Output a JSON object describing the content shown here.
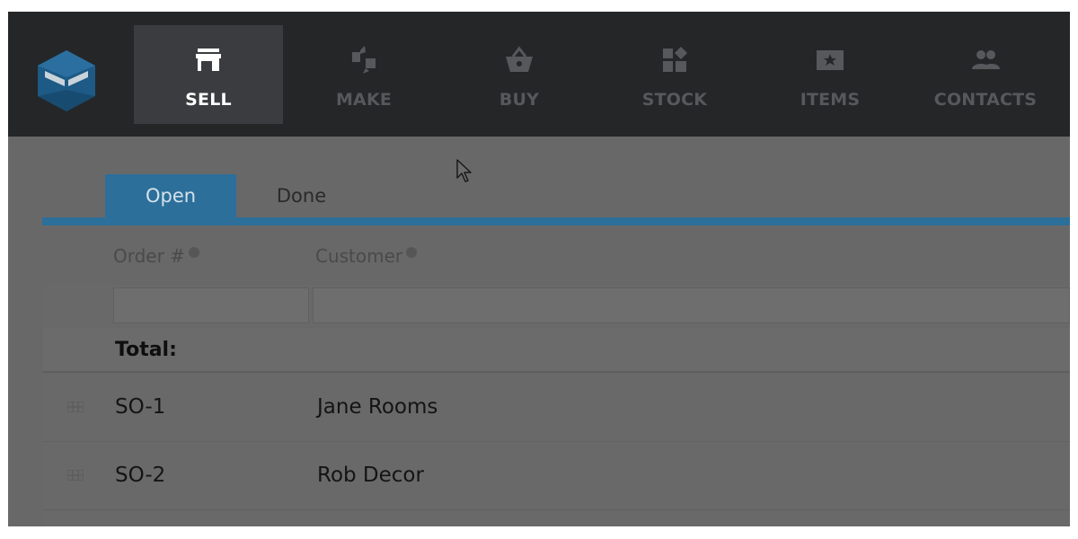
{
  "nav": {
    "items": [
      {
        "label": "SELL",
        "icon": "store-icon",
        "active": true
      },
      {
        "label": "MAKE",
        "icon": "make-icon",
        "active": false
      },
      {
        "label": "BUY",
        "icon": "basket-icon",
        "active": false
      },
      {
        "label": "STOCK",
        "icon": "stock-icon",
        "active": false
      },
      {
        "label": "ITEMS",
        "icon": "items-icon",
        "active": false
      },
      {
        "label": "CONTACTS",
        "icon": "contacts-icon",
        "active": false
      }
    ]
  },
  "tabs": [
    {
      "label": "Open",
      "active": true
    },
    {
      "label": "Done",
      "active": false
    }
  ],
  "table": {
    "columns": [
      {
        "label": "Order #"
      },
      {
        "label": "Customer"
      }
    ],
    "filters": {
      "order": "",
      "customer": ""
    },
    "total_label": "Total:",
    "rows": [
      {
        "order": "SO-1",
        "customer": "Jane Rooms"
      },
      {
        "order": "SO-2",
        "customer": "Rob Decor"
      }
    ]
  },
  "colors": {
    "topbar": "#252628",
    "accent": "#2c6f9a",
    "overlay": "#6c6c6c"
  }
}
